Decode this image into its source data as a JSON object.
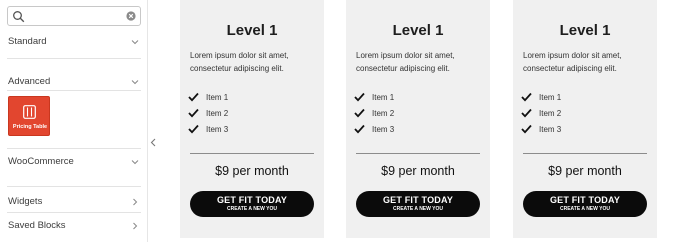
{
  "sidebar": {
    "search": {
      "placeholder": "",
      "value": ""
    },
    "panels": [
      {
        "label": "Standard",
        "state": "collapsed"
      },
      {
        "label": "Advanced",
        "state": "expanded"
      },
      {
        "label": "WooCommerce",
        "state": "collapsed"
      },
      {
        "label": "Widgets",
        "state": "collapsed"
      },
      {
        "label": "Saved Blocks",
        "state": "collapsed"
      }
    ],
    "block": {
      "label": "Pricing Table",
      "icon": "pricing-table-icon",
      "color": "#e2462f"
    }
  },
  "cards": [
    {
      "title": "Level 1",
      "description": "Lorem ipsum dolor sit amet, consectetur adipiscing elit.",
      "features": [
        "Item 1",
        "Item 2",
        "Item 3"
      ],
      "price": "$9 per month",
      "button": {
        "label": "GET FIT TODAY",
        "sublabel": "CREATE A NEW YOU"
      }
    },
    {
      "title": "Level 1",
      "description": "Lorem ipsum dolor sit amet, consectetur adipiscing elit.",
      "features": [
        "Item 1",
        "Item 2",
        "Item 3"
      ],
      "price": "$9 per month",
      "button": {
        "label": "GET FIT TODAY",
        "sublabel": "CREATE A NEW YOU"
      }
    },
    {
      "title": "Level 1",
      "description": "Lorem ipsum dolor sit amet, consectetur adipiscing elit.",
      "features": [
        "Item 1",
        "Item 2",
        "Item 3"
      ],
      "price": "$9 per month",
      "button": {
        "label": "GET FIT TODAY",
        "sublabel": "CREATE A NEW YOU"
      }
    }
  ],
  "colors": {
    "card_bg": "#f0f0f0",
    "button_bg": "#0b0b0b",
    "accent": "#e2462f"
  }
}
